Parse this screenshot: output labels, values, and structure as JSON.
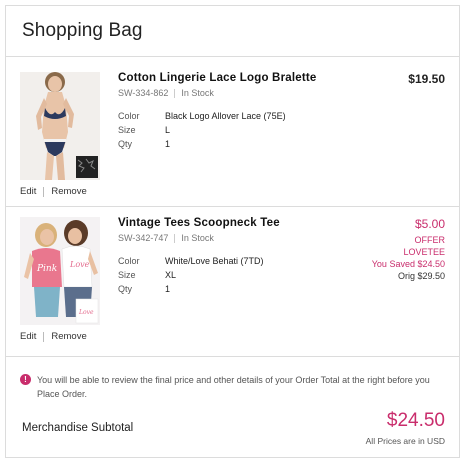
{
  "header": {
    "title": "Shopping Bag"
  },
  "items": [
    {
      "name": "Cotton Lingerie Lace Logo Bralette",
      "sku": "SW-334-862",
      "stock": "In Stock",
      "attributes": [
        {
          "label": "Color",
          "value": "Black Logo Allover Lace (75E)"
        },
        {
          "label": "Size",
          "value": "L"
        },
        {
          "label": "Qty",
          "value": "1"
        }
      ],
      "price": "$19.50",
      "edit_label": "Edit",
      "remove_label": "Remove"
    },
    {
      "name": "Vintage Tees Scoopneck Tee",
      "sku": "SW-342-747",
      "stock": "In Stock",
      "attributes": [
        {
          "label": "Color",
          "value": "White/Love Behati (7TD)"
        },
        {
          "label": "Size",
          "value": "XL"
        },
        {
          "label": "Qty",
          "value": "1"
        }
      ],
      "price": "$5.00",
      "offer_label": "OFFER",
      "offer_code": "LOVETEE",
      "saved": "You Saved $24.50",
      "orig": "Orig $29.50",
      "edit_label": "Edit",
      "remove_label": "Remove"
    }
  ],
  "notice": {
    "icon": "info-icon",
    "text": "You will be able to review the final price and other details of your Order Total at the right before you Place Order."
  },
  "summary": {
    "subtotal_label": "Merchandise Subtotal",
    "subtotal_amount": "$24.50",
    "currency_note": "All Prices are in USD"
  },
  "colors": {
    "accent": "#c92d6c",
    "border": "#dcdcdc"
  }
}
